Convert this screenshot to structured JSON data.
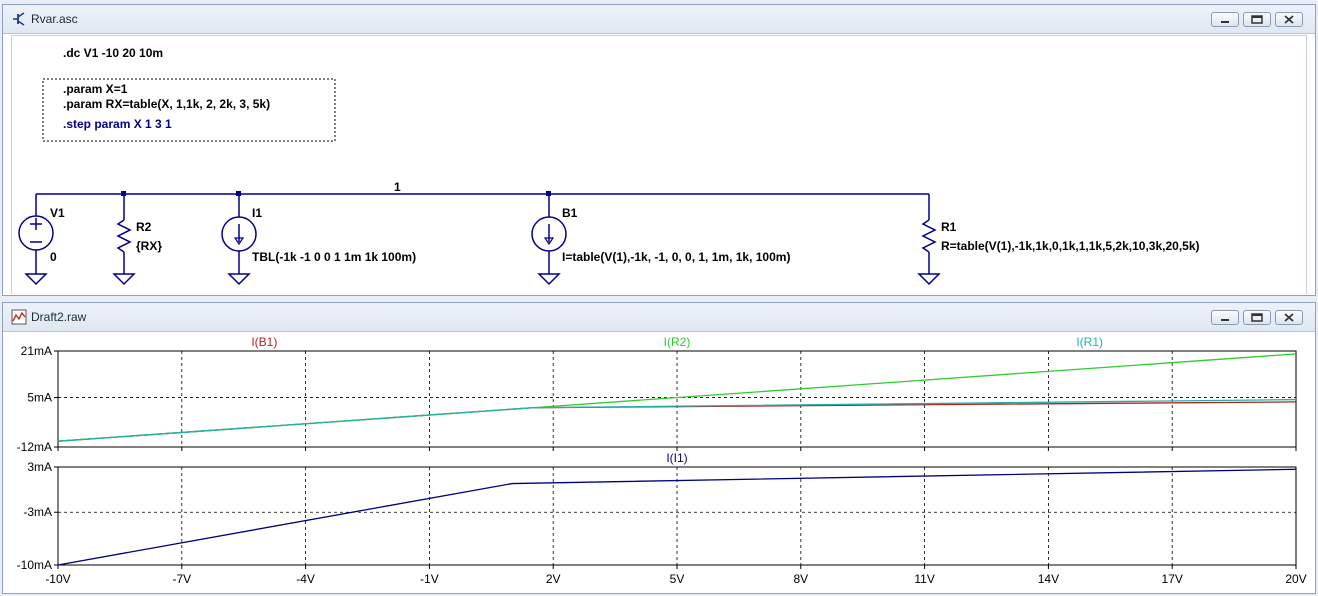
{
  "schematic_window": {
    "title": "Rvar.asc",
    "directives": {
      "dc": ".dc V1 -10 20 10m",
      "param_x": ".param X=1",
      "param_rx": ".param RX=table(X, 1,1k, 2, 2k, 3, 5k)",
      "step": ".step param X 1 3 1"
    },
    "net_label": "1",
    "components": {
      "v1": {
        "name": "V1",
        "value": "0"
      },
      "r2": {
        "name": "R2",
        "value": "{RX}"
      },
      "i1": {
        "name": "I1",
        "value": "TBL(-1k -1 0 0 1 1m 1k 100m)"
      },
      "b1": {
        "name": "B1",
        "value": "I=table(V(1),-1k, -1, 0, 0, 1, 1m, 1k, 100m)"
      },
      "r1": {
        "name": "R1",
        "value": "R=table(V(1),-1k,1k,0,1k,1,1k,5,2k,10,3k,20,5k)"
      }
    }
  },
  "plot_window": {
    "title": "Draft2.raw"
  },
  "colors": {
    "ib1": "#b22222",
    "ir2": "#2ecc2e",
    "ir1": "#20b2aa",
    "ii1": "#000080"
  },
  "chart_data": [
    {
      "type": "line",
      "series": [
        {
          "name": "I(B1)",
          "x": [
            -10,
            1.5,
            20
          ],
          "y": [
            -10,
            1.5,
            3.5
          ]
        },
        {
          "name": "I(R2)",
          "x": [
            -10,
            1.5,
            20
          ],
          "y": [
            -10,
            1.5,
            20
          ]
        },
        {
          "name": "I(R1)",
          "x": [
            -10,
            1.5,
            20
          ],
          "y": [
            -10,
            1.5,
            4.3
          ]
        }
      ],
      "ylim": [
        -12,
        21
      ],
      "yticks": [
        "21mA",
        "5mA",
        "-12mA"
      ],
      "ytick_values": [
        21,
        5,
        -12
      ],
      "xlim": [
        -10,
        20
      ],
      "grid": true
    },
    {
      "type": "line",
      "series": [
        {
          "name": "I(I1)",
          "x": [
            -10,
            1,
            20
          ],
          "y": [
            -10,
            0.8,
            2.7
          ]
        }
      ],
      "ylim": [
        -10,
        3
      ],
      "yticks": [
        "3mA",
        "-3mA",
        "-10mA"
      ],
      "ytick_values": [
        3,
        -3,
        -10
      ],
      "xlim": [
        -10,
        20
      ],
      "xticks": [
        "-10V",
        "-7V",
        "-4V",
        "-1V",
        "2V",
        "5V",
        "8V",
        "11V",
        "14V",
        "17V",
        "20V"
      ],
      "xtick_values": [
        -10,
        -7,
        -4,
        -1,
        2,
        5,
        8,
        11,
        14,
        17,
        20
      ],
      "grid": true
    }
  ]
}
